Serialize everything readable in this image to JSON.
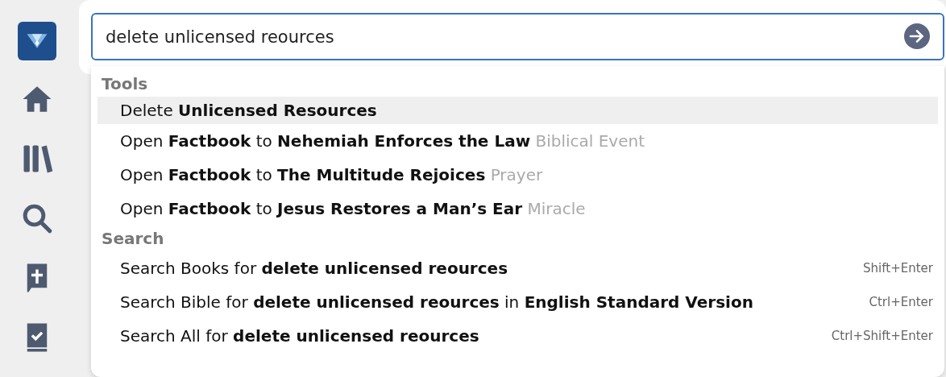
{
  "sidebar": {
    "items": [
      {
        "kind": "logo"
      },
      {
        "kind": "home"
      },
      {
        "kind": "library"
      },
      {
        "kind": "search"
      },
      {
        "kind": "bible"
      },
      {
        "kind": "checklist"
      }
    ]
  },
  "search": {
    "value": "delete unlicensed reources"
  },
  "sections": [
    {
      "title": "Tools",
      "items": [
        {
          "text": "Delete **Unlicensed Resources**",
          "selected": true
        },
        {
          "text": "Open **Factbook** to **Nehemiah Enforces the Law**",
          "category": "Biblical Event",
          "selected": false
        },
        {
          "text": "Open **Factbook** to **The Multitude Rejoices**",
          "category": "Prayer",
          "selected": false
        },
        {
          "text": "Open **Factbook** to **Jesus Restores a Man’s Ear**",
          "category": "Miracle",
          "selected": false
        }
      ]
    },
    {
      "title": "Search",
      "items": [
        {
          "text": "Search Books for **delete unlicensed reources**",
          "shortcut": "Shift+Enter",
          "selected": false
        },
        {
          "text": "Search Bible for **delete unlicensed reources** in **English Standard Version**",
          "shortcut": "Ctrl+Enter",
          "selected": false
        },
        {
          "text": "Search All for **delete unlicensed reources**",
          "shortcut": "Ctrl+Shift+Enter",
          "selected": false
        }
      ]
    }
  ]
}
